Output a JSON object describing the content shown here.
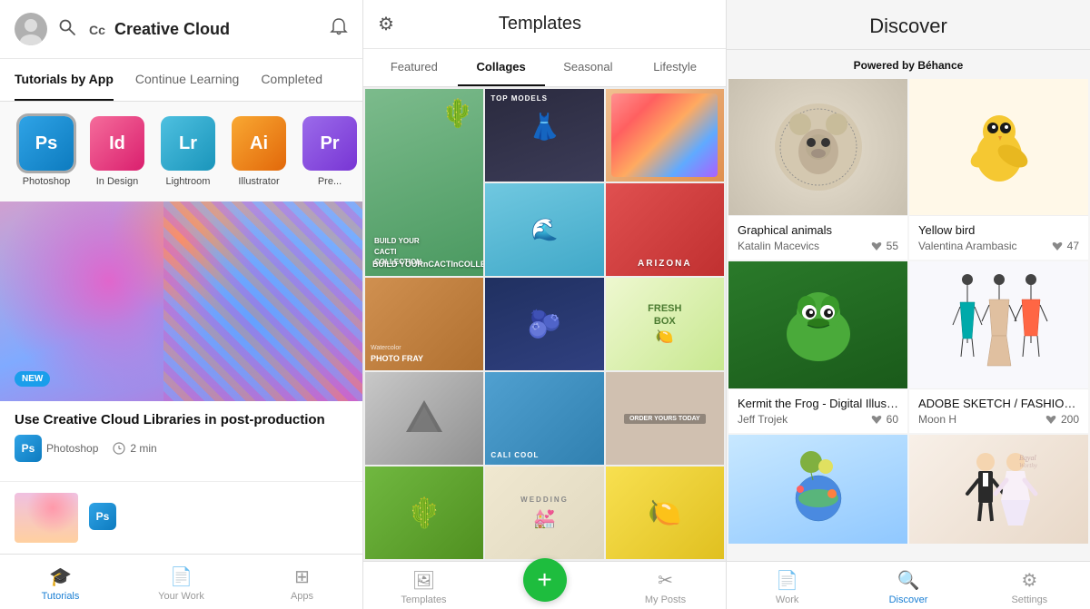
{
  "left": {
    "header": {
      "title": "Creative Cloud"
    },
    "tabs": [
      {
        "id": "tutorials-by-app",
        "label": "Tutorials by App",
        "active": true
      },
      {
        "id": "continue-learning",
        "label": "Continue Learning",
        "active": false
      },
      {
        "id": "completed",
        "label": "Completed",
        "active": false
      }
    ],
    "apps": [
      {
        "id": "ps",
        "label": "Photoshop",
        "abbr": "Ps",
        "color": "ps-color",
        "selected": true
      },
      {
        "id": "id",
        "label": "In Design",
        "abbr": "Id",
        "color": "id-color",
        "selected": false
      },
      {
        "id": "lr",
        "label": "Lightroom",
        "abbr": "Lr",
        "color": "lr-color",
        "selected": false
      },
      {
        "id": "ai",
        "label": "Illustrator",
        "abbr": "Ai",
        "color": "ai-color",
        "selected": false
      },
      {
        "id": "pre",
        "label": "Pre...",
        "abbr": "Pr",
        "color": "pre-color",
        "selected": false
      }
    ],
    "tutorial": {
      "badge": "NEW",
      "title": "Use Creative Cloud Libraries in post-production",
      "app": "Photoshop",
      "duration": "2 min"
    },
    "bottom_nav": [
      {
        "id": "tutorials",
        "label": "Tutorials",
        "active": true,
        "icon": "🎓"
      },
      {
        "id": "your-work",
        "label": "Your Work",
        "active": false,
        "icon": "📄"
      },
      {
        "id": "apps",
        "label": "Apps",
        "active": false,
        "icon": "⊞"
      }
    ]
  },
  "middle": {
    "title": "Templates",
    "tabs": [
      {
        "id": "featured",
        "label": "Featured",
        "active": false
      },
      {
        "id": "collages",
        "label": "Collages",
        "active": true
      },
      {
        "id": "seasonal",
        "label": "Seasonal",
        "active": false
      },
      {
        "id": "lifestyle",
        "label": "Lifestyle",
        "active": false
      }
    ],
    "templates": [
      {
        "id": "t1",
        "text": "BUILD YOUR\nCACTI COLLECTION",
        "span": "tall"
      },
      {
        "id": "t2",
        "text": "TOP MODELS",
        "span": ""
      },
      {
        "id": "t3",
        "text": "",
        "span": ""
      },
      {
        "id": "t4",
        "text": "",
        "span": ""
      },
      {
        "id": "t5",
        "text": "ARIZONA",
        "span": ""
      },
      {
        "id": "t6",
        "text": "Watercolor\nPHOTO FRAY",
        "span": ""
      },
      {
        "id": "t7",
        "text": "",
        "span": ""
      },
      {
        "id": "t8",
        "text": "FRESH\nBOX",
        "span": ""
      },
      {
        "id": "t9",
        "text": "",
        "span": ""
      },
      {
        "id": "t10",
        "text": "CALI COOL",
        "span": ""
      },
      {
        "id": "t11",
        "text": "",
        "span": ""
      },
      {
        "id": "t12",
        "text": "ORDER YOURS TODAY",
        "span": ""
      },
      {
        "id": "t13",
        "text": "",
        "span": ""
      },
      {
        "id": "t14",
        "text": "WEDDING",
        "span": ""
      },
      {
        "id": "t15",
        "text": "",
        "span": ""
      }
    ],
    "bottom_nav": [
      {
        "id": "templates",
        "label": "Templates",
        "active": false,
        "icon": "🖼"
      },
      {
        "id": "add",
        "label": "",
        "active": false,
        "icon": "+"
      },
      {
        "id": "my-posts",
        "label": "My Posts",
        "active": false,
        "icon": "✂"
      }
    ]
  },
  "right": {
    "title": "Discover",
    "powered_by": "Powered by",
    "behance": "Béhance",
    "items": [
      {
        "id": "graphical-animals",
        "title": "Graphical animals",
        "author": "Katalin Macevics",
        "likes": "55",
        "emoji": "🐻"
      },
      {
        "id": "yellow-bird",
        "title": "Yellow bird",
        "author": "Valentina Arambasic",
        "likes": "47",
        "emoji": "🐤"
      },
      {
        "id": "kermit",
        "title": "Kermit the Frog - Digital Illust...",
        "author": "Jeff Trojek",
        "likes": "60",
        "emoji": "🐸"
      },
      {
        "id": "adobe-sketch",
        "title": "ADOBE SKETCH / FASHION I...",
        "author": "Moon H",
        "likes": "200",
        "emoji": "👗"
      },
      {
        "id": "planet",
        "title": "",
        "author": "",
        "likes": "",
        "emoji": "🌍"
      },
      {
        "id": "wedding",
        "title": "",
        "author": "",
        "likes": "",
        "emoji": "💒"
      }
    ],
    "bottom_nav": [
      {
        "id": "work",
        "label": "Work",
        "active": false,
        "icon": "📄"
      },
      {
        "id": "discover",
        "label": "Discover",
        "active": true,
        "icon": "🔍"
      },
      {
        "id": "settings",
        "label": "Settings",
        "active": false,
        "icon": "⚙"
      }
    ]
  }
}
